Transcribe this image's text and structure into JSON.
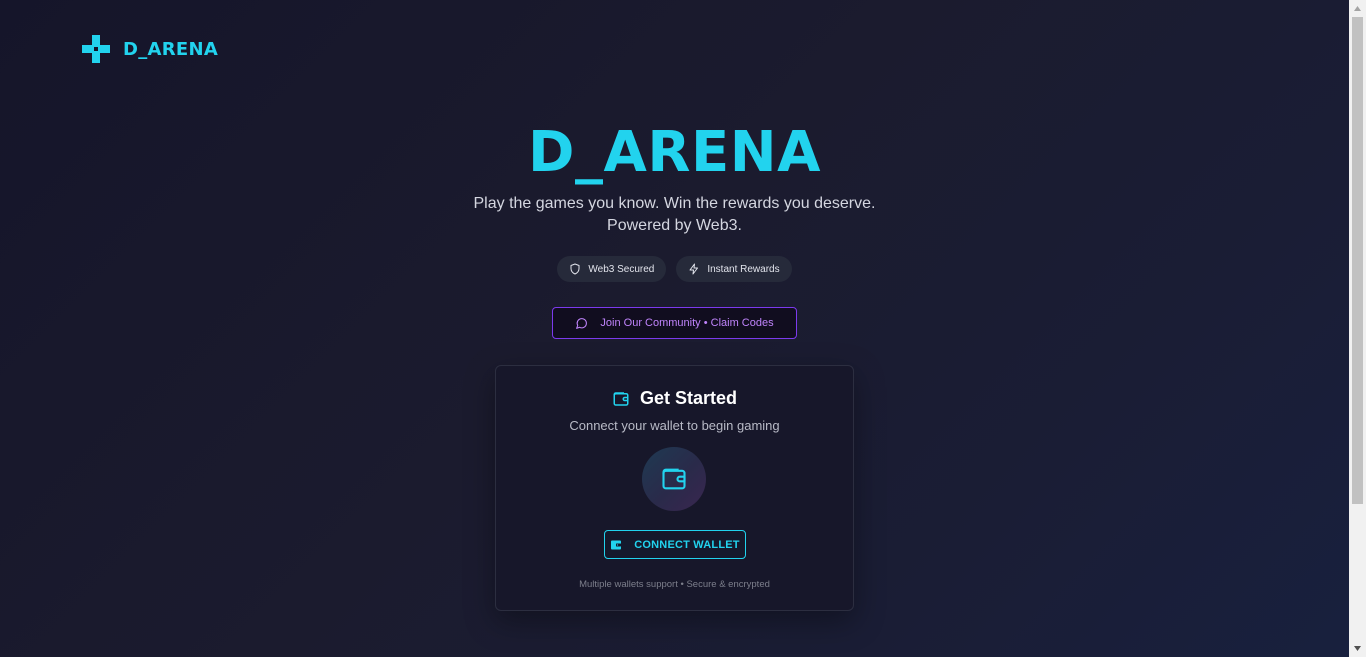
{
  "header": {
    "logo_text": "D_ARENA",
    "logo_icon": "gamepad-plus-icon"
  },
  "hero": {
    "title": "D_ARENA",
    "subtitle_line1": "Play the games you know. Win the rewards you deserve.",
    "subtitle_line2": "Powered by Web3."
  },
  "badges": [
    {
      "icon": "shield-icon",
      "label": "Web3 Secured"
    },
    {
      "icon": "lightning-icon",
      "label": "Instant Rewards"
    }
  ],
  "community_button": {
    "icon": "chat-bubble-icon",
    "label": "Join Our Community • Claim Codes"
  },
  "card": {
    "icon": "wallet-icon",
    "title": "Get Started",
    "description": "Connect your wallet to begin gaming",
    "connect_label": "CONNECT WALLET",
    "footer": "Multiple wallets support • Secure & encrypted"
  },
  "colors": {
    "accent": "#22d3ee",
    "purple": "#c084fc",
    "background": "#1b1b2e"
  }
}
